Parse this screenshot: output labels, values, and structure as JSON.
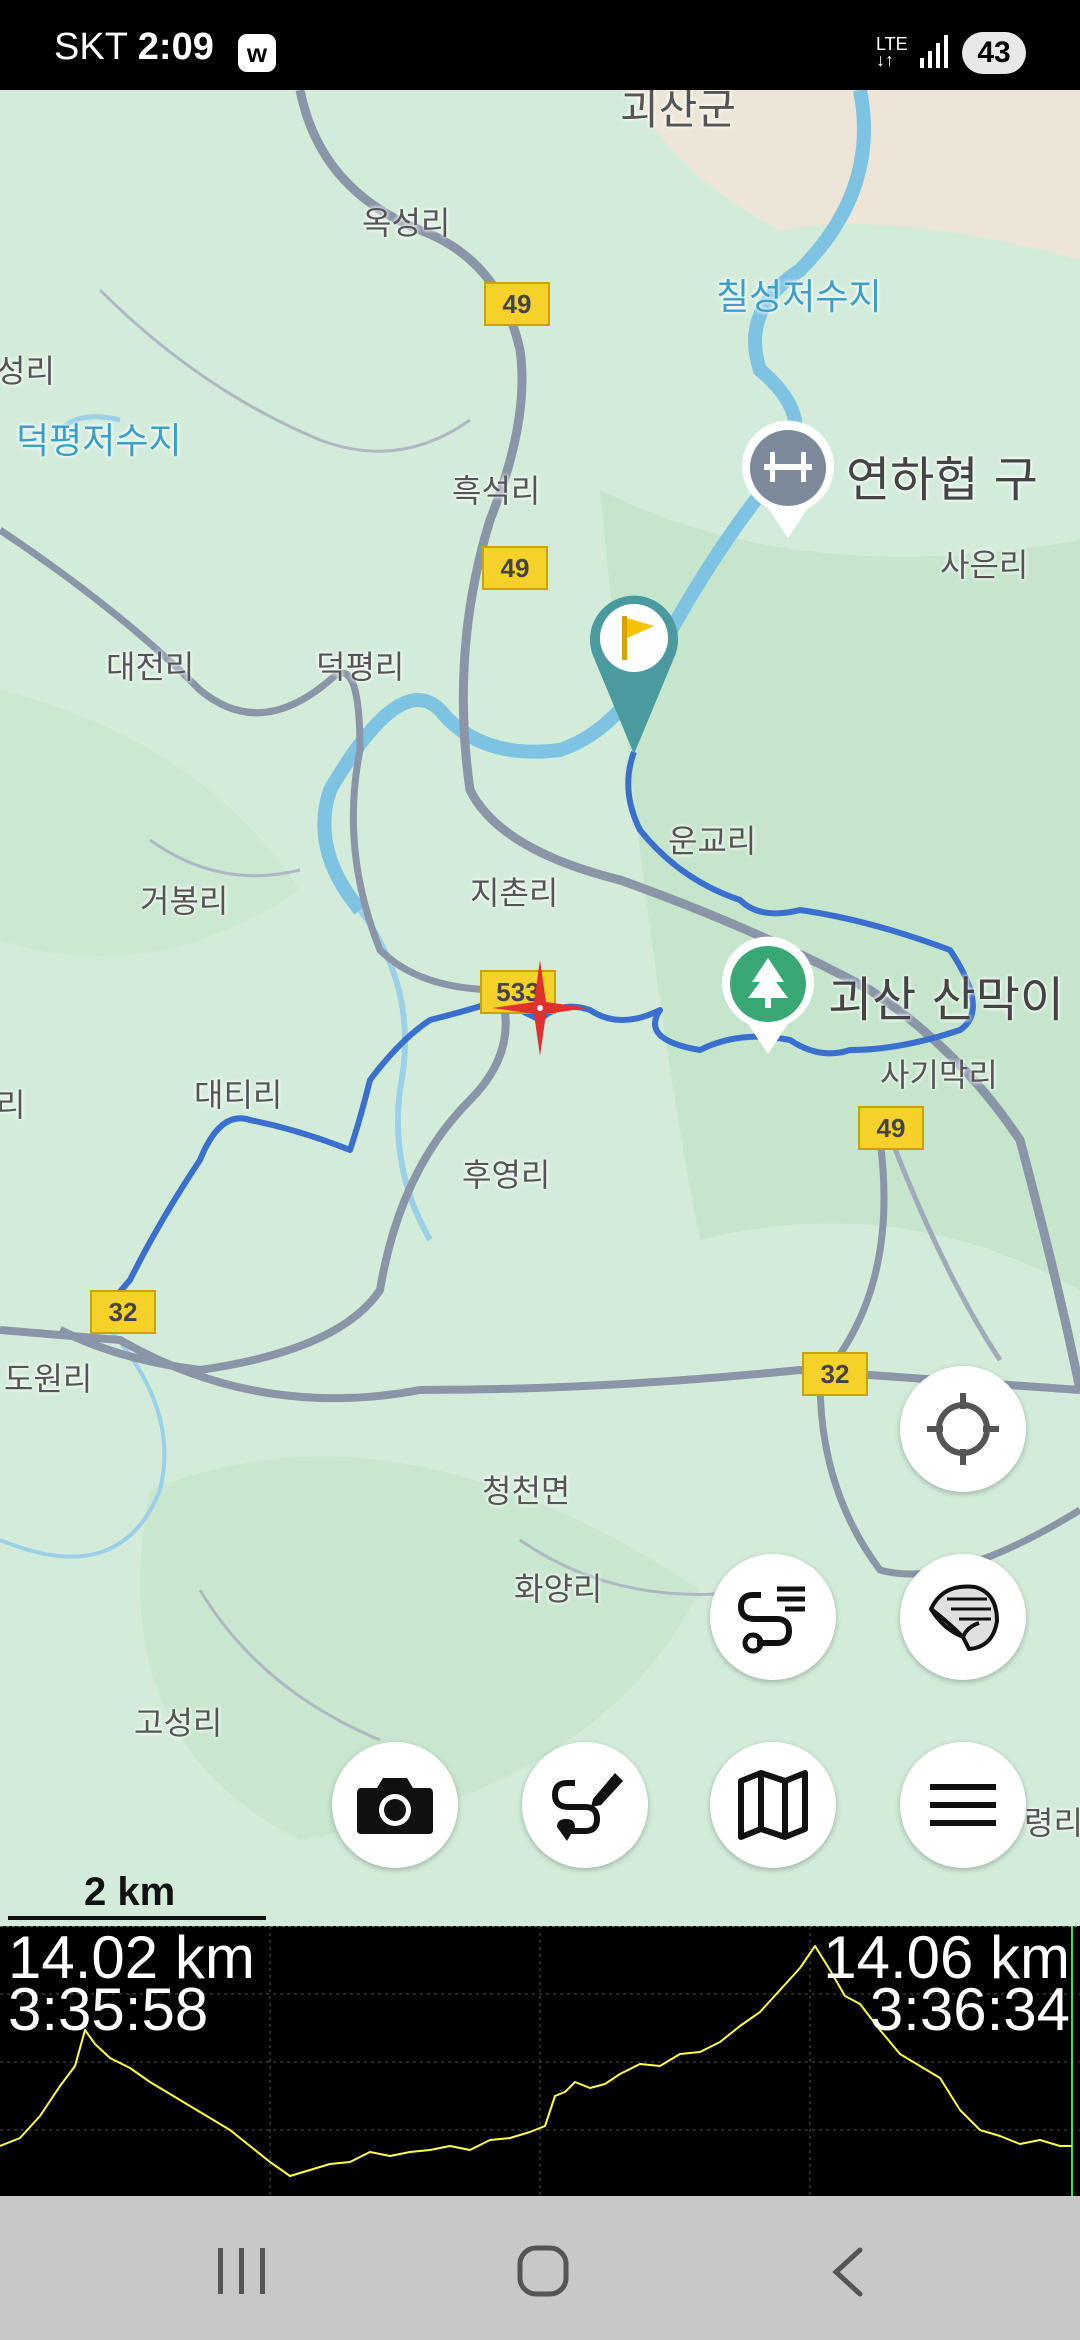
{
  "status_bar": {
    "carrier": "SKT",
    "time": "2:09",
    "app_badge": "w",
    "network": "LTE",
    "battery": "43"
  },
  "map": {
    "places": {
      "goesan_gun": "괴산군",
      "okseong_ri": "옥성리",
      "chilseong_reservoir": "칠성저수지",
      "seong_ri": "성리",
      "deokpyeong_reservoir": "덕평저수지",
      "yeonhahyeop": "연하협 구",
      "heukseok_ri": "흑석리",
      "saeun_ri": "사은리",
      "daejeon_ri": "대전리",
      "deokpyeong_ri": "덕평리",
      "ungyo_ri": "운교리",
      "jichon_ri": "지촌리",
      "geobong_ri": "거봉리",
      "goesan_sanmakye": "괴산 산막이",
      "sagimak_ri": "사기막리",
      "ri_left": "리",
      "daeti_ri": "대티리",
      "huyeong_ri": "후영리",
      "dowon_ri": "도원리",
      "cheongcheon_myeon": "청천면",
      "hwayang_ri": "화양리",
      "goseong_ri": "고성리",
      "ri_right": "령리"
    },
    "road_shields": {
      "r49_a": "49",
      "r49_b": "49",
      "r533": "533",
      "r49_c": "49",
      "r32_a": "32",
      "r32_b": "32"
    },
    "scale_label": "2 km"
  },
  "controls": {
    "locate": "crosshair-icon",
    "layers": "layers-icon",
    "tracks": "tracks-icon",
    "camera": "camera-icon",
    "route_edit": "route-edit-icon",
    "map_select": "map-icon",
    "menu": "menu-icon"
  },
  "elevation": {
    "left_distance": "14.02 km",
    "left_time": "3:35:58",
    "right_distance": "14.06 km",
    "right_time": "3:36:34",
    "line_color": "#ffff44"
  },
  "nav_bar": {
    "recents": "recents-icon",
    "home": "home-icon",
    "back": "back-icon"
  }
}
